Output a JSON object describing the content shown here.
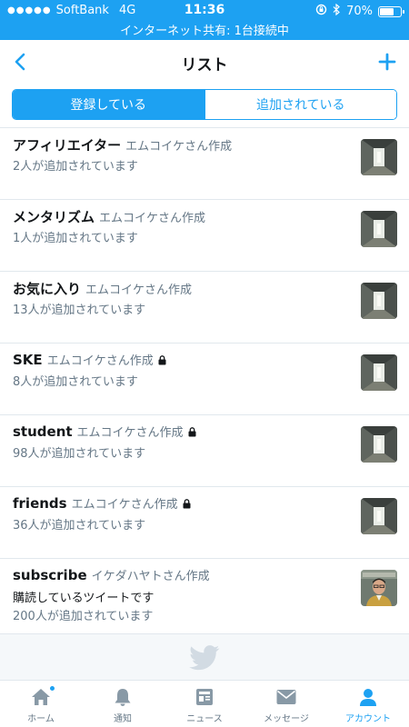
{
  "status_bar": {
    "carrier": "SoftBank",
    "network": "4G",
    "time": "11:36",
    "battery": "70%",
    "battery_level": 0.7,
    "hotspot": "インターネット共有: 1台接続中"
  },
  "nav": {
    "title": "リスト",
    "back_icon": "chevron-left-icon",
    "add_icon": "plus-icon"
  },
  "segments": [
    {
      "label": "登録している",
      "active": true
    },
    {
      "label": "追加されている",
      "active": false
    }
  ],
  "lists": [
    {
      "name": "アフィリエイター",
      "creator": "エムコイケさん作成",
      "locked": false,
      "description": "",
      "count": "2人が追加されています",
      "thumb": "hallway"
    },
    {
      "name": "メンタリズム",
      "creator": "エムコイケさん作成",
      "locked": false,
      "description": "",
      "count": "1人が追加されています",
      "thumb": "hallway"
    },
    {
      "name": "お気に入り",
      "creator": "エムコイケさん作成",
      "locked": false,
      "description": "",
      "count": "13人が追加されています",
      "thumb": "hallway"
    },
    {
      "name": "SKE",
      "creator": "エムコイケさん作成",
      "locked": true,
      "description": "",
      "count": "8人が追加されています",
      "thumb": "hallway"
    },
    {
      "name": "student",
      "creator": "エムコイケさん作成",
      "locked": true,
      "description": "",
      "count": "98人が追加されています",
      "thumb": "hallway"
    },
    {
      "name": "friends",
      "creator": "エムコイケさん作成",
      "locked": true,
      "description": "",
      "count": "36人が追加されています",
      "thumb": "hallway"
    },
    {
      "name": "subscribe",
      "creator": "イケダハヤトさん作成",
      "locked": false,
      "description": "購読しているツイートです",
      "count": "200人が追加されています",
      "thumb": "person"
    }
  ],
  "tabs": [
    {
      "label": "ホーム",
      "icon": "home-icon",
      "active": false,
      "badge": true
    },
    {
      "label": "通知",
      "icon": "bell-icon",
      "active": false,
      "badge": false
    },
    {
      "label": "ニュース",
      "icon": "news-icon",
      "active": false,
      "badge": false
    },
    {
      "label": "メッセージ",
      "icon": "envelope-icon",
      "active": false,
      "badge": false
    },
    {
      "label": "アカウント",
      "icon": "person-icon",
      "active": true,
      "badge": false
    }
  ],
  "colors": {
    "accent": "#1da1f2",
    "text": "#14171a",
    "secondary_text": "#657786",
    "tab_inactive": "#8899a6"
  }
}
